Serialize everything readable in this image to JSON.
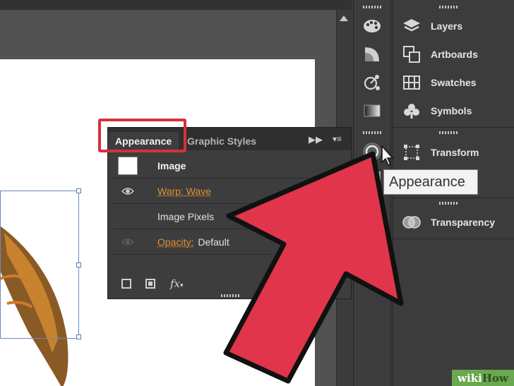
{
  "right_panel": {
    "items": [
      {
        "label": "Layers",
        "icon": "layers-icon"
      },
      {
        "label": "Artboards",
        "icon": "artboards-icon"
      },
      {
        "label": "Swatches",
        "icon": "swatches-icon"
      },
      {
        "label": "Symbols",
        "icon": "symbols-icon"
      },
      {
        "label": "Transform",
        "icon": "transform-icon"
      },
      {
        "label": "Transparency",
        "icon": "transparency-icon"
      }
    ]
  },
  "appearance_panel": {
    "tabs": [
      {
        "label": "Appearance",
        "active": true
      },
      {
        "label": "Graphic Styles",
        "active": false
      }
    ],
    "rows": {
      "object": "Image",
      "effect_name": "Warp: Wave",
      "pixels": "Image Pixels",
      "opacity_label": "Opacity:",
      "opacity_value": "Default"
    },
    "fx_label": "fx"
  },
  "tooltip": "Appearance",
  "watermark": {
    "part1": "wiki",
    "part2": "How"
  },
  "colors": {
    "highlight_red": "#d5313c",
    "arrow_red": "#e0354a",
    "orange_text": "#e29034",
    "panel_bg": "#3c3c3c"
  }
}
